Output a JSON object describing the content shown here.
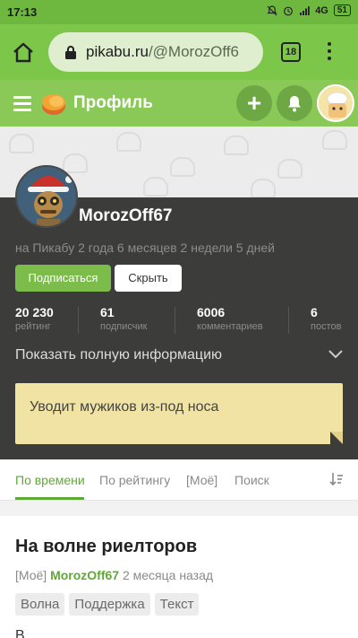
{
  "status_bar": {
    "time": "17:13",
    "network": "4G",
    "battery": "51"
  },
  "browser": {
    "url_domain": "pikabu.ru",
    "url_path": "/@MorozOff6",
    "tab_count": "18"
  },
  "header": {
    "title": "Профиль",
    "add_symbol": "+"
  },
  "profile": {
    "username": "MorozOff67",
    "member_since": "на Пикабу 2 года 6 месяцев 2 недели 5 дней",
    "subscribe_label": "Подписаться",
    "hide_label": "Скрыть",
    "stats": [
      {
        "value": "20 230",
        "label": "рейтинг"
      },
      {
        "value": "61",
        "label": "подписчик"
      },
      {
        "value": "6006",
        "label": "комментариев"
      },
      {
        "value": "6",
        "label": "постов"
      }
    ],
    "show_info_label": "Показать полную информацию",
    "note_text": "Уводит мужиков из-под носа"
  },
  "tabs": [
    {
      "label": "По времени",
      "active": true
    },
    {
      "label": "По рейтингу",
      "active": false
    },
    {
      "label": "[Моё]",
      "active": false
    },
    {
      "label": "Поиск",
      "active": false
    }
  ],
  "post": {
    "title": "На волне риелторов",
    "mine_tag": "[Моё]",
    "author": "MorozOff67",
    "time_ago": "2 месяца назад",
    "tags": [
      "Волна",
      "Поддержка",
      "Текст"
    ],
    "text_start": "В"
  },
  "colors": {
    "accent_green": "#6fb83f",
    "profile_bg": "#3c3d3b",
    "note_bg": "#f0e3a3"
  }
}
